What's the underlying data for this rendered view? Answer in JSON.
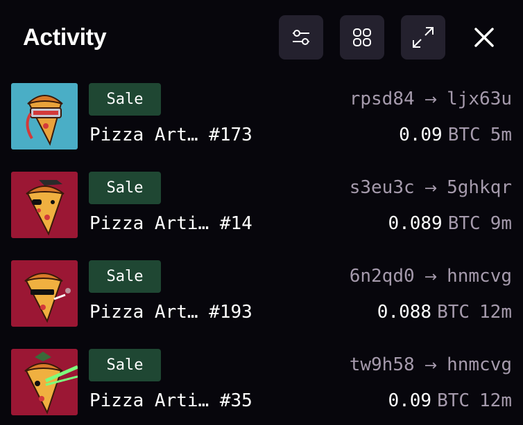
{
  "header": {
    "title": "Activity",
    "buttons": {
      "filter_icon": "sliders-icon",
      "grid_icon": "grid-icon",
      "expand_icon": "expand-icon",
      "close_icon": "close-icon"
    }
  },
  "colors": {
    "background": "#07060c",
    "button_bg": "#24212e",
    "badge_bg": "#1f4733",
    "muted_text": "#a59aac",
    "thumb_blue": "#4aaec6",
    "thumb_red": "#9b1734"
  },
  "activity": [
    {
      "type": "Sale",
      "name": "Pizza Art… #173",
      "from": "rpsd84",
      "to": "ljx63u",
      "price": "0.09",
      "currency": "BTC",
      "ago": "5m",
      "thumb_bg": "#4aaec6"
    },
    {
      "type": "Sale",
      "name": "Pizza Arti… #14",
      "from": "s3eu3c",
      "to": "5ghkqr",
      "price": "0.089",
      "currency": "BTC",
      "ago": "9m",
      "thumb_bg": "#9b1734"
    },
    {
      "type": "Sale",
      "name": "Pizza Art… #193",
      "from": "6n2qd0",
      "to": "hnmcvg",
      "price": "0.088",
      "currency": "BTC",
      "ago": "12m",
      "thumb_bg": "#9b1734"
    },
    {
      "type": "Sale",
      "name": "Pizza Arti… #35",
      "from": "tw9h58",
      "to": "hnmcvg",
      "price": "0.09",
      "currency": "BTC",
      "ago": "12m",
      "thumb_bg": "#9b1734"
    }
  ]
}
